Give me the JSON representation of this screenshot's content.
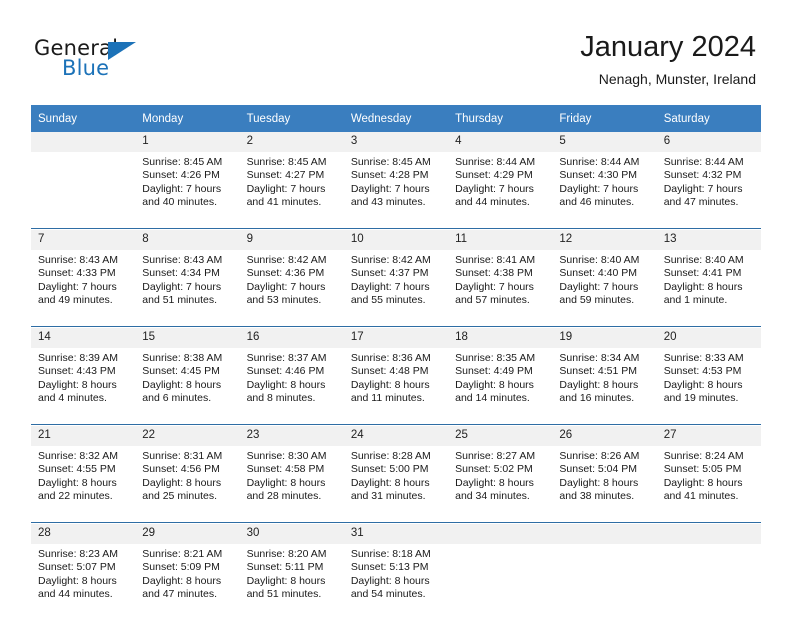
{
  "brand": {
    "word_one": "General",
    "word_two": "Blue",
    "logo_icon": "triangle-logo-icon",
    "accent_color": "#1c72b8"
  },
  "header": {
    "title": "January 2024",
    "subtitle": "Nenagh, Munster, Ireland"
  },
  "theme": {
    "header_bar_color": "#3a7ebf",
    "week_separator_color": "#2e6da4",
    "daynum_band_color": "#f1f1f1"
  },
  "calendar": {
    "weekday_headers": [
      "Sunday",
      "Monday",
      "Tuesday",
      "Wednesday",
      "Thursday",
      "Friday",
      "Saturday"
    ],
    "weeks": [
      {
        "days": [
          {
            "num": "",
            "sunrise": "",
            "sunset": "",
            "daylight_line1": "",
            "daylight_line2": "",
            "empty": true
          },
          {
            "num": "1",
            "sunrise": "Sunrise: 8:45 AM",
            "sunset": "Sunset: 4:26 PM",
            "daylight_line1": "Daylight: 7 hours",
            "daylight_line2": "and 40 minutes.",
            "empty": false
          },
          {
            "num": "2",
            "sunrise": "Sunrise: 8:45 AM",
            "sunset": "Sunset: 4:27 PM",
            "daylight_line1": "Daylight: 7 hours",
            "daylight_line2": "and 41 minutes.",
            "empty": false
          },
          {
            "num": "3",
            "sunrise": "Sunrise: 8:45 AM",
            "sunset": "Sunset: 4:28 PM",
            "daylight_line1": "Daylight: 7 hours",
            "daylight_line2": "and 43 minutes.",
            "empty": false
          },
          {
            "num": "4",
            "sunrise": "Sunrise: 8:44 AM",
            "sunset": "Sunset: 4:29 PM",
            "daylight_line1": "Daylight: 7 hours",
            "daylight_line2": "and 44 minutes.",
            "empty": false
          },
          {
            "num": "5",
            "sunrise": "Sunrise: 8:44 AM",
            "sunset": "Sunset: 4:30 PM",
            "daylight_line1": "Daylight: 7 hours",
            "daylight_line2": "and 46 minutes.",
            "empty": false
          },
          {
            "num": "6",
            "sunrise": "Sunrise: 8:44 AM",
            "sunset": "Sunset: 4:32 PM",
            "daylight_line1": "Daylight: 7 hours",
            "daylight_line2": "and 47 minutes.",
            "empty": false
          }
        ]
      },
      {
        "days": [
          {
            "num": "7",
            "sunrise": "Sunrise: 8:43 AM",
            "sunset": "Sunset: 4:33 PM",
            "daylight_line1": "Daylight: 7 hours",
            "daylight_line2": "and 49 minutes.",
            "empty": false
          },
          {
            "num": "8",
            "sunrise": "Sunrise: 8:43 AM",
            "sunset": "Sunset: 4:34 PM",
            "daylight_line1": "Daylight: 7 hours",
            "daylight_line2": "and 51 minutes.",
            "empty": false
          },
          {
            "num": "9",
            "sunrise": "Sunrise: 8:42 AM",
            "sunset": "Sunset: 4:36 PM",
            "daylight_line1": "Daylight: 7 hours",
            "daylight_line2": "and 53 minutes.",
            "empty": false
          },
          {
            "num": "10",
            "sunrise": "Sunrise: 8:42 AM",
            "sunset": "Sunset: 4:37 PM",
            "daylight_line1": "Daylight: 7 hours",
            "daylight_line2": "and 55 minutes.",
            "empty": false
          },
          {
            "num": "11",
            "sunrise": "Sunrise: 8:41 AM",
            "sunset": "Sunset: 4:38 PM",
            "daylight_line1": "Daylight: 7 hours",
            "daylight_line2": "and 57 minutes.",
            "empty": false
          },
          {
            "num": "12",
            "sunrise": "Sunrise: 8:40 AM",
            "sunset": "Sunset: 4:40 PM",
            "daylight_line1": "Daylight: 7 hours",
            "daylight_line2": "and 59 minutes.",
            "empty": false
          },
          {
            "num": "13",
            "sunrise": "Sunrise: 8:40 AM",
            "sunset": "Sunset: 4:41 PM",
            "daylight_line1": "Daylight: 8 hours",
            "daylight_line2": "and 1 minute.",
            "empty": false
          }
        ]
      },
      {
        "days": [
          {
            "num": "14",
            "sunrise": "Sunrise: 8:39 AM",
            "sunset": "Sunset: 4:43 PM",
            "daylight_line1": "Daylight: 8 hours",
            "daylight_line2": "and 4 minutes.",
            "empty": false
          },
          {
            "num": "15",
            "sunrise": "Sunrise: 8:38 AM",
            "sunset": "Sunset: 4:45 PM",
            "daylight_line1": "Daylight: 8 hours",
            "daylight_line2": "and 6 minutes.",
            "empty": false
          },
          {
            "num": "16",
            "sunrise": "Sunrise: 8:37 AM",
            "sunset": "Sunset: 4:46 PM",
            "daylight_line1": "Daylight: 8 hours",
            "daylight_line2": "and 8 minutes.",
            "empty": false
          },
          {
            "num": "17",
            "sunrise": "Sunrise: 8:36 AM",
            "sunset": "Sunset: 4:48 PM",
            "daylight_line1": "Daylight: 8 hours",
            "daylight_line2": "and 11 minutes.",
            "empty": false
          },
          {
            "num": "18",
            "sunrise": "Sunrise: 8:35 AM",
            "sunset": "Sunset: 4:49 PM",
            "daylight_line1": "Daylight: 8 hours",
            "daylight_line2": "and 14 minutes.",
            "empty": false
          },
          {
            "num": "19",
            "sunrise": "Sunrise: 8:34 AM",
            "sunset": "Sunset: 4:51 PM",
            "daylight_line1": "Daylight: 8 hours",
            "daylight_line2": "and 16 minutes.",
            "empty": false
          },
          {
            "num": "20",
            "sunrise": "Sunrise: 8:33 AM",
            "sunset": "Sunset: 4:53 PM",
            "daylight_line1": "Daylight: 8 hours",
            "daylight_line2": "and 19 minutes.",
            "empty": false
          }
        ]
      },
      {
        "days": [
          {
            "num": "21",
            "sunrise": "Sunrise: 8:32 AM",
            "sunset": "Sunset: 4:55 PM",
            "daylight_line1": "Daylight: 8 hours",
            "daylight_line2": "and 22 minutes.",
            "empty": false
          },
          {
            "num": "22",
            "sunrise": "Sunrise: 8:31 AM",
            "sunset": "Sunset: 4:56 PM",
            "daylight_line1": "Daylight: 8 hours",
            "daylight_line2": "and 25 minutes.",
            "empty": false
          },
          {
            "num": "23",
            "sunrise": "Sunrise: 8:30 AM",
            "sunset": "Sunset: 4:58 PM",
            "daylight_line1": "Daylight: 8 hours",
            "daylight_line2": "and 28 minutes.",
            "empty": false
          },
          {
            "num": "24",
            "sunrise": "Sunrise: 8:28 AM",
            "sunset": "Sunset: 5:00 PM",
            "daylight_line1": "Daylight: 8 hours",
            "daylight_line2": "and 31 minutes.",
            "empty": false
          },
          {
            "num": "25",
            "sunrise": "Sunrise: 8:27 AM",
            "sunset": "Sunset: 5:02 PM",
            "daylight_line1": "Daylight: 8 hours",
            "daylight_line2": "and 34 minutes.",
            "empty": false
          },
          {
            "num": "26",
            "sunrise": "Sunrise: 8:26 AM",
            "sunset": "Sunset: 5:04 PM",
            "daylight_line1": "Daylight: 8 hours",
            "daylight_line2": "and 38 minutes.",
            "empty": false
          },
          {
            "num": "27",
            "sunrise": "Sunrise: 8:24 AM",
            "sunset": "Sunset: 5:05 PM",
            "daylight_line1": "Daylight: 8 hours",
            "daylight_line2": "and 41 minutes.",
            "empty": false
          }
        ]
      },
      {
        "days": [
          {
            "num": "28",
            "sunrise": "Sunrise: 8:23 AM",
            "sunset": "Sunset: 5:07 PM",
            "daylight_line1": "Daylight: 8 hours",
            "daylight_line2": "and 44 minutes.",
            "empty": false
          },
          {
            "num": "29",
            "sunrise": "Sunrise: 8:21 AM",
            "sunset": "Sunset: 5:09 PM",
            "daylight_line1": "Daylight: 8 hours",
            "daylight_line2": "and 47 minutes.",
            "empty": false
          },
          {
            "num": "30",
            "sunrise": "Sunrise: 8:20 AM",
            "sunset": "Sunset: 5:11 PM",
            "daylight_line1": "Daylight: 8 hours",
            "daylight_line2": "and 51 minutes.",
            "empty": false
          },
          {
            "num": "31",
            "sunrise": "Sunrise: 8:18 AM",
            "sunset": "Sunset: 5:13 PM",
            "daylight_line1": "Daylight: 8 hours",
            "daylight_line2": "and 54 minutes.",
            "empty": false
          },
          {
            "num": "",
            "sunrise": "",
            "sunset": "",
            "daylight_line1": "",
            "daylight_line2": "",
            "empty": true
          },
          {
            "num": "",
            "sunrise": "",
            "sunset": "",
            "daylight_line1": "",
            "daylight_line2": "",
            "empty": true
          },
          {
            "num": "",
            "sunrise": "",
            "sunset": "",
            "daylight_line1": "",
            "daylight_line2": "",
            "empty": true
          }
        ]
      }
    ]
  }
}
